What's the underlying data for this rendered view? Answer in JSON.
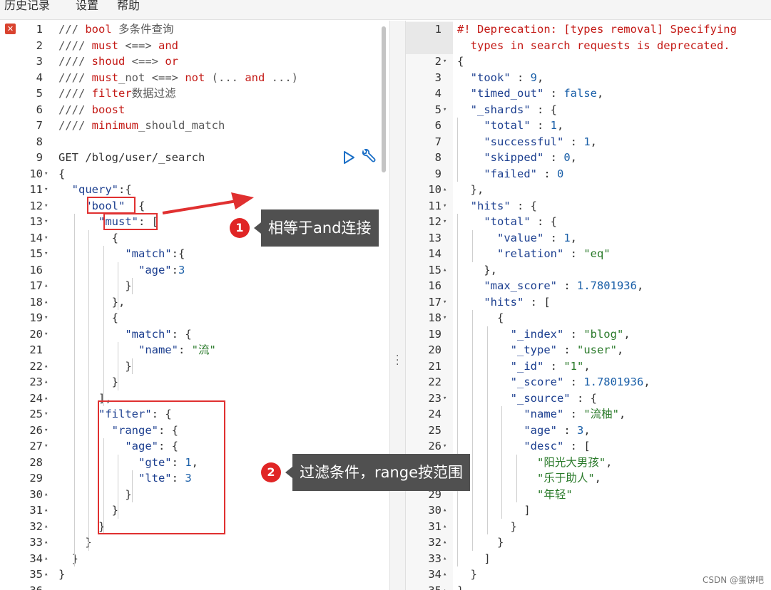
{
  "menu": [
    "历史记录",
    "设置",
    "帮助"
  ],
  "left_editor": {
    "lines": [
      {
        "n": "1",
        "fold": "",
        "parts": [
          [
            "c-cmt",
            "/// "
          ],
          [
            "c-kw",
            "bool"
          ],
          [
            "c-cmt",
            " 多条件查询"
          ]
        ]
      },
      {
        "n": "2",
        "fold": "",
        "parts": [
          [
            "c-cmt",
            "//// "
          ],
          [
            "c-kw",
            "must"
          ],
          [
            "c-cmt",
            " <==> "
          ],
          [
            "c-kw",
            "and"
          ]
        ]
      },
      {
        "n": "3",
        "fold": "",
        "parts": [
          [
            "c-cmt",
            "//// "
          ],
          [
            "c-kw",
            "shoud"
          ],
          [
            "c-cmt",
            " <==> "
          ],
          [
            "c-kw",
            "or"
          ]
        ]
      },
      {
        "n": "4",
        "fold": "",
        "parts": [
          [
            "c-cmt",
            "//// "
          ],
          [
            "c-kw",
            "must"
          ],
          [
            "c-cmt",
            "_not <==> "
          ],
          [
            "c-kw",
            "not"
          ],
          [
            "c-cmt",
            " (... "
          ],
          [
            "c-kw",
            "and"
          ],
          [
            "c-cmt",
            " ...)"
          ]
        ]
      },
      {
        "n": "5",
        "fold": "",
        "parts": [
          [
            "c-cmt",
            "//// "
          ],
          [
            "c-kw",
            "filter"
          ],
          [
            "c-cmt",
            "数据过滤"
          ]
        ]
      },
      {
        "n": "6",
        "fold": "",
        "parts": [
          [
            "c-cmt",
            "//// "
          ],
          [
            "c-kw",
            "boost"
          ]
        ]
      },
      {
        "n": "7",
        "fold": "",
        "parts": [
          [
            "c-cmt",
            "//// "
          ],
          [
            "c-kw",
            "minimum"
          ],
          [
            "c-cmt",
            "_should_match"
          ]
        ]
      },
      {
        "n": "8",
        "fold": "",
        "parts": []
      },
      {
        "n": "9",
        "fold": "",
        "parts": [
          [
            "c-method",
            "GET /blog/user/_search"
          ]
        ]
      },
      {
        "n": "10",
        "fold": "▾",
        "parts": [
          [
            "c-punc",
            "{"
          ]
        ]
      },
      {
        "n": "11",
        "fold": "▾",
        "parts": [
          [
            "c-punc",
            "  "
          ],
          [
            "c-key",
            "\"query\""
          ],
          [
            "c-punc",
            ":{"
          ]
        ]
      },
      {
        "n": "12",
        "fold": "▾",
        "parts": [
          [
            "c-punc",
            "    "
          ],
          [
            "c-key",
            "\"bool\""
          ],
          [
            "c-punc",
            "  {"
          ]
        ]
      },
      {
        "n": "13",
        "fold": "▾",
        "parts": [
          [
            "c-punc",
            "      "
          ],
          [
            "c-key",
            "\"must\""
          ],
          [
            "c-punc",
            ": ["
          ]
        ]
      },
      {
        "n": "14",
        "fold": "▾",
        "parts": [
          [
            "c-punc",
            "        {"
          ]
        ]
      },
      {
        "n": "15",
        "fold": "▾",
        "parts": [
          [
            "c-punc",
            "          "
          ],
          [
            "c-key",
            "\"match\""
          ],
          [
            "c-punc",
            ":{"
          ]
        ]
      },
      {
        "n": "16",
        "fold": "",
        "parts": [
          [
            "c-punc",
            "            "
          ],
          [
            "c-key",
            "\"age\""
          ],
          [
            "c-punc",
            ":"
          ],
          [
            "c-num",
            "3"
          ]
        ]
      },
      {
        "n": "17",
        "fold": "▴",
        "parts": [
          [
            "c-punc",
            "          }"
          ]
        ]
      },
      {
        "n": "18",
        "fold": "▴",
        "parts": [
          [
            "c-punc",
            "        },"
          ]
        ]
      },
      {
        "n": "19",
        "fold": "▾",
        "parts": [
          [
            "c-punc",
            "        {"
          ]
        ]
      },
      {
        "n": "20",
        "fold": "▾",
        "parts": [
          [
            "c-punc",
            "          "
          ],
          [
            "c-key",
            "\"match\""
          ],
          [
            "c-punc",
            ": {"
          ]
        ]
      },
      {
        "n": "21",
        "fold": "",
        "parts": [
          [
            "c-punc",
            "            "
          ],
          [
            "c-key",
            "\"name\""
          ],
          [
            "c-punc",
            ": "
          ],
          [
            "c-str",
            "\"流\""
          ]
        ]
      },
      {
        "n": "22",
        "fold": "▴",
        "parts": [
          [
            "c-punc",
            "          }"
          ]
        ]
      },
      {
        "n": "23",
        "fold": "▴",
        "parts": [
          [
            "c-punc",
            "        }"
          ]
        ]
      },
      {
        "n": "24",
        "fold": "▴",
        "parts": [
          [
            "c-punc",
            "      ],"
          ]
        ]
      },
      {
        "n": "25",
        "fold": "▾",
        "parts": [
          [
            "c-punc",
            "      "
          ],
          [
            "c-key",
            "\"filter\""
          ],
          [
            "c-punc",
            ": {"
          ]
        ]
      },
      {
        "n": "26",
        "fold": "▾",
        "parts": [
          [
            "c-punc",
            "        "
          ],
          [
            "c-key",
            "\"range\""
          ],
          [
            "c-punc",
            ": {"
          ]
        ]
      },
      {
        "n": "27",
        "fold": "▾",
        "parts": [
          [
            "c-punc",
            "          "
          ],
          [
            "c-key",
            "\"age\""
          ],
          [
            "c-punc",
            ": {"
          ]
        ]
      },
      {
        "n": "28",
        "fold": "",
        "parts": [
          [
            "c-punc",
            "            "
          ],
          [
            "c-key",
            "\"gte\""
          ],
          [
            "c-punc",
            ": "
          ],
          [
            "c-num",
            "1"
          ],
          [
            "c-punc",
            ","
          ]
        ]
      },
      {
        "n": "29",
        "fold": "",
        "parts": [
          [
            "c-punc",
            "            "
          ],
          [
            "c-key",
            "\"lte\""
          ],
          [
            "c-punc",
            ": "
          ],
          [
            "c-num",
            "3"
          ]
        ]
      },
      {
        "n": "30",
        "fold": "▴",
        "parts": [
          [
            "c-punc",
            "          }"
          ]
        ]
      },
      {
        "n": "31",
        "fold": "▴",
        "parts": [
          [
            "c-punc",
            "        }"
          ]
        ]
      },
      {
        "n": "32",
        "fold": "▴",
        "parts": [
          [
            "c-punc",
            "      }"
          ]
        ]
      },
      {
        "n": "33",
        "fold": "▴",
        "parts": [
          [
            "c-punc",
            "    }"
          ]
        ]
      },
      {
        "n": "34",
        "fold": "▴",
        "parts": [
          [
            "c-punc",
            "  }"
          ]
        ]
      },
      {
        "n": "35",
        "fold": "▴",
        "parts": [
          [
            "c-punc",
            "}"
          ]
        ]
      },
      {
        "n": "36",
        "fold": "",
        "parts": []
      }
    ]
  },
  "right_editor": {
    "lines": [
      {
        "n": "1",
        "fold": "",
        "parts": [
          [
            "c-warn",
            "#! Deprecation: [types removal] Specifying"
          ]
        ]
      },
      {
        "n": "",
        "fold": "",
        "parts": [
          [
            "c-warn",
            "  types in search requests is deprecated."
          ]
        ]
      },
      {
        "n": "2",
        "fold": "▾",
        "parts": [
          [
            "c-punc",
            "{"
          ]
        ]
      },
      {
        "n": "3",
        "fold": "",
        "parts": [
          [
            "c-punc",
            "  "
          ],
          [
            "c-key",
            "\"took\""
          ],
          [
            "c-punc",
            " : "
          ],
          [
            "c-num",
            "9"
          ],
          [
            "c-punc",
            ","
          ]
        ]
      },
      {
        "n": "4",
        "fold": "",
        "parts": [
          [
            "c-punc",
            "  "
          ],
          [
            "c-key",
            "\"timed_out\""
          ],
          [
            "c-punc",
            " : "
          ],
          [
            "c-bool",
            "false"
          ],
          [
            "c-punc",
            ","
          ]
        ]
      },
      {
        "n": "5",
        "fold": "▾",
        "parts": [
          [
            "c-punc",
            "  "
          ],
          [
            "c-key",
            "\"_shards\""
          ],
          [
            "c-punc",
            " : {"
          ]
        ]
      },
      {
        "n": "6",
        "fold": "",
        "parts": [
          [
            "c-punc",
            "    "
          ],
          [
            "c-key",
            "\"total\""
          ],
          [
            "c-punc",
            " : "
          ],
          [
            "c-num",
            "1"
          ],
          [
            "c-punc",
            ","
          ]
        ]
      },
      {
        "n": "7",
        "fold": "",
        "parts": [
          [
            "c-punc",
            "    "
          ],
          [
            "c-key",
            "\"successful\""
          ],
          [
            "c-punc",
            " : "
          ],
          [
            "c-num",
            "1"
          ],
          [
            "c-punc",
            ","
          ]
        ]
      },
      {
        "n": "8",
        "fold": "",
        "parts": [
          [
            "c-punc",
            "    "
          ],
          [
            "c-key",
            "\"skipped\""
          ],
          [
            "c-punc",
            " : "
          ],
          [
            "c-num",
            "0"
          ],
          [
            "c-punc",
            ","
          ]
        ]
      },
      {
        "n": "9",
        "fold": "",
        "parts": [
          [
            "c-punc",
            "    "
          ],
          [
            "c-key",
            "\"failed\""
          ],
          [
            "c-punc",
            " : "
          ],
          [
            "c-num",
            "0"
          ]
        ]
      },
      {
        "n": "10",
        "fold": "▴",
        "parts": [
          [
            "c-punc",
            "  },"
          ]
        ]
      },
      {
        "n": "11",
        "fold": "▾",
        "parts": [
          [
            "c-punc",
            "  "
          ],
          [
            "c-key",
            "\"hits\""
          ],
          [
            "c-punc",
            " : {"
          ]
        ]
      },
      {
        "n": "12",
        "fold": "▾",
        "parts": [
          [
            "c-punc",
            "    "
          ],
          [
            "c-key",
            "\"total\""
          ],
          [
            "c-punc",
            " : {"
          ]
        ]
      },
      {
        "n": "13",
        "fold": "",
        "parts": [
          [
            "c-punc",
            "      "
          ],
          [
            "c-key",
            "\"value\""
          ],
          [
            "c-punc",
            " : "
          ],
          [
            "c-num",
            "1"
          ],
          [
            "c-punc",
            ","
          ]
        ]
      },
      {
        "n": "14",
        "fold": "",
        "parts": [
          [
            "c-punc",
            "      "
          ],
          [
            "c-key",
            "\"relation\""
          ],
          [
            "c-punc",
            " : "
          ],
          [
            "c-str",
            "\"eq\""
          ]
        ]
      },
      {
        "n": "15",
        "fold": "▴",
        "parts": [
          [
            "c-punc",
            "    },"
          ]
        ]
      },
      {
        "n": "16",
        "fold": "",
        "parts": [
          [
            "c-punc",
            "    "
          ],
          [
            "c-key",
            "\"max_score\""
          ],
          [
            "c-punc",
            " : "
          ],
          [
            "c-num",
            "1.7801936"
          ],
          [
            "c-punc",
            ","
          ]
        ]
      },
      {
        "n": "17",
        "fold": "▾",
        "parts": [
          [
            "c-punc",
            "    "
          ],
          [
            "c-key",
            "\"hits\""
          ],
          [
            "c-punc",
            " : ["
          ]
        ]
      },
      {
        "n": "18",
        "fold": "▾",
        "parts": [
          [
            "c-punc",
            "      {"
          ]
        ]
      },
      {
        "n": "19",
        "fold": "",
        "parts": [
          [
            "c-punc",
            "        "
          ],
          [
            "c-key",
            "\"_index\""
          ],
          [
            "c-punc",
            " : "
          ],
          [
            "c-str",
            "\"blog\""
          ],
          [
            "c-punc",
            ","
          ]
        ]
      },
      {
        "n": "20",
        "fold": "",
        "parts": [
          [
            "c-punc",
            "        "
          ],
          [
            "c-key",
            "\"_type\""
          ],
          [
            "c-punc",
            " : "
          ],
          [
            "c-str",
            "\"user\""
          ],
          [
            "c-punc",
            ","
          ]
        ]
      },
      {
        "n": "21",
        "fold": "",
        "parts": [
          [
            "c-punc",
            "        "
          ],
          [
            "c-key",
            "\"_id\""
          ],
          [
            "c-punc",
            " : "
          ],
          [
            "c-str",
            "\"1\""
          ],
          [
            "c-punc",
            ","
          ]
        ]
      },
      {
        "n": "22",
        "fold": "",
        "parts": [
          [
            "c-punc",
            "        "
          ],
          [
            "c-key",
            "\"_score\""
          ],
          [
            "c-punc",
            " : "
          ],
          [
            "c-num",
            "1.7801936"
          ],
          [
            "c-punc",
            ","
          ]
        ]
      },
      {
        "n": "23",
        "fold": "▾",
        "parts": [
          [
            "c-punc",
            "        "
          ],
          [
            "c-key",
            "\"_source\""
          ],
          [
            "c-punc",
            " : {"
          ]
        ]
      },
      {
        "n": "24",
        "fold": "",
        "parts": [
          [
            "c-punc",
            "          "
          ],
          [
            "c-key",
            "\"name\""
          ],
          [
            "c-punc",
            " : "
          ],
          [
            "c-str",
            "\"流柚\""
          ],
          [
            "c-punc",
            ","
          ]
        ]
      },
      {
        "n": "25",
        "fold": "",
        "parts": [
          [
            "c-punc",
            "          "
          ],
          [
            "c-key",
            "\"age\""
          ],
          [
            "c-punc",
            " : "
          ],
          [
            "c-num",
            "3"
          ],
          [
            "c-punc",
            ","
          ]
        ]
      },
      {
        "n": "26",
        "fold": "▾",
        "parts": [
          [
            "c-punc",
            "          "
          ],
          [
            "c-key",
            "\"desc\""
          ],
          [
            "c-punc",
            " : ["
          ]
        ]
      },
      {
        "n": "27",
        "fold": "",
        "parts": [
          [
            "c-punc",
            "            "
          ],
          [
            "c-str",
            "\"阳光大男孩\""
          ],
          [
            "c-punc",
            ","
          ]
        ]
      },
      {
        "n": "28",
        "fold": "",
        "parts": [
          [
            "c-punc",
            "            "
          ],
          [
            "c-str",
            "\"乐于助人\""
          ],
          [
            "c-punc",
            ","
          ]
        ]
      },
      {
        "n": "29",
        "fold": "",
        "parts": [
          [
            "c-punc",
            "            "
          ],
          [
            "c-str",
            "\"年轻\""
          ]
        ]
      },
      {
        "n": "30",
        "fold": "▴",
        "parts": [
          [
            "c-punc",
            "          ]"
          ]
        ]
      },
      {
        "n": "31",
        "fold": "▴",
        "parts": [
          [
            "c-punc",
            "        }"
          ]
        ]
      },
      {
        "n": "32",
        "fold": "▴",
        "parts": [
          [
            "c-punc",
            "      }"
          ]
        ]
      },
      {
        "n": "33",
        "fold": "▴",
        "parts": [
          [
            "c-punc",
            "    ]"
          ]
        ]
      },
      {
        "n": "34",
        "fold": "▴",
        "parts": [
          [
            "c-punc",
            "  }"
          ]
        ]
      },
      {
        "n": "35",
        "fold": "▴",
        "parts": [
          [
            "c-punc",
            "}"
          ]
        ]
      }
    ]
  },
  "annotations": {
    "callout1": {
      "num": "1",
      "text": "相等于and连接"
    },
    "callout2": {
      "num": "2",
      "text": "过滤条件，range按范围"
    }
  },
  "watermark": "CSDN @蛋饼吧",
  "error_mark": "✕",
  "colors": {
    "annotation_red": "#e03030",
    "callout_bg": "#505050"
  }
}
